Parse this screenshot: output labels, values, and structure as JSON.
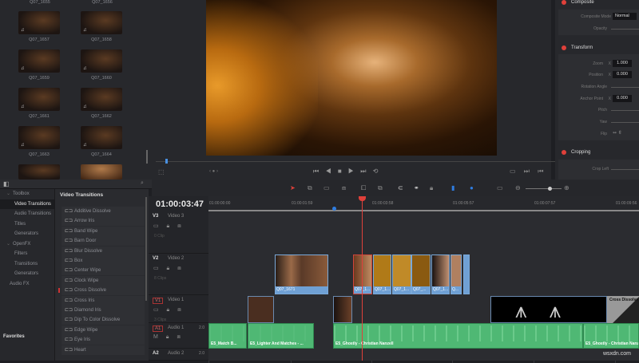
{
  "media_pool": {
    "clips": [
      {
        "name": "Q07_1655"
      },
      {
        "name": "Q07_1656"
      },
      {
        "name": "Q07_1657"
      },
      {
        "name": "Q07_1658"
      },
      {
        "name": "Q07_1659"
      },
      {
        "name": "Q07_1660"
      },
      {
        "name": "Q07_1661"
      },
      {
        "name": "Q07_1662"
      },
      {
        "name": "Q07_1663"
      },
      {
        "name": "Q07_1664"
      }
    ],
    "audio_icon": "♫"
  },
  "viewer": {
    "transport": [
      "⏮",
      "◀",
      "■",
      "▶",
      "⏭",
      "⟲"
    ],
    "nav": "‹ ● ›"
  },
  "inspector": {
    "composite": {
      "title": "Composite",
      "mode_label": "Composite Mode",
      "mode_value": "Normal",
      "opacity_label": "Opacity"
    },
    "transform": {
      "title": "Transform",
      "zoom_label": "Zoom",
      "zoom_x": "1.000",
      "position_label": "Position",
      "position_x": "0.000",
      "rotation_label": "Rotation Angle",
      "anchor_label": "Anchor Point",
      "anchor_x": "0.000",
      "pitch_label": "Pitch",
      "yaw_label": "Yaw",
      "flip_label": "Flip",
      "axis": "X"
    },
    "cropping": {
      "title": "Cropping",
      "crop_left_label": "Crop Left"
    }
  },
  "effects": {
    "tree": [
      {
        "label": "Toolbox"
      },
      {
        "label": "Video Transitions"
      },
      {
        "label": "Audio Transitions"
      },
      {
        "label": "Titles"
      },
      {
        "label": "Generators"
      },
      {
        "label": "OpenFX"
      },
      {
        "label": "Filters"
      },
      {
        "label": "Transitions"
      },
      {
        "label": "Generators"
      },
      {
        "label": "Audio FX"
      }
    ],
    "favorites": "Favorites",
    "list_title": "Video Transitions",
    "items": [
      "Additive Dissolve",
      "Arrow Iris",
      "Band Wipe",
      "Barn Door",
      "Blur Dissolve",
      "Box",
      "Center Wipe",
      "Clock Wipe",
      "Cross Dissolve",
      "Cross Iris",
      "Diamond Iris",
      "Dip To Color Dissolve",
      "Edge Wipe",
      "Eye Iris",
      "Heart"
    ]
  },
  "timeline": {
    "timecode": "01:00:03:47",
    "ruler": [
      "01:00:00:00",
      "01:00:01:59",
      "01:00:03:58",
      "01:00:05:57",
      "01:00:07:57",
      "01:00:09:56"
    ],
    "tracks": [
      {
        "id": "V3",
        "name": "Video 3",
        "count": "0 Clip"
      },
      {
        "id": "V2",
        "name": "Video 2",
        "count": "8 Clips"
      },
      {
        "id": "V1",
        "name": "Video 1",
        "count": "3 Clips"
      },
      {
        "id": "A1",
        "name": "Audio 1",
        "channels": "2.0"
      },
      {
        "id": "A2",
        "name": "Audio 2",
        "channels": "2.0"
      }
    ],
    "v2_clips": [
      "Q07_1671",
      "Q07_1...",
      "Q07_1...",
      "Q07_1...",
      "Q07_...",
      "Q07_1...",
      "Q..."
    ],
    "v1_transition": "Cross Dissolve",
    "audio_clips": [
      "E5_Match B...",
      "E5_Lighter And Matches - ...",
      "E5_Ghostly - Christian Nanzell",
      "E5_Ghostly - Christian Nanze"
    ]
  },
  "watermark": "wsxdn.com"
}
